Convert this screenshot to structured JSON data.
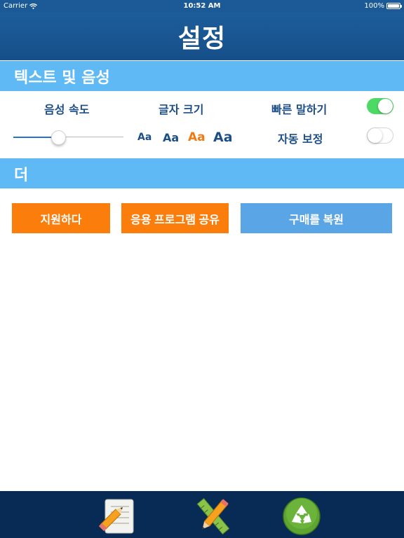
{
  "status_bar": {
    "carrier": "Carrier",
    "time": "10:52 AM",
    "battery": "100%"
  },
  "header": {
    "title": "설정"
  },
  "sections": {
    "text_and_voice": "텍스트 및 음성",
    "more": "더"
  },
  "settings": {
    "voice_speed_label": "음성 속도",
    "voice_speed_value": 0.4,
    "font_size_label": "글자 크기",
    "font_options": [
      "Aa",
      "Aa",
      "Aa",
      "Aa"
    ],
    "font_selected_index": 2,
    "fast_speech_label": "빠른 말하기",
    "fast_speech_on": true,
    "auto_correct_label": "자동 보정",
    "auto_correct_on": false
  },
  "buttons": {
    "support": "지원하다",
    "share_app": "응용 프로그램 공유",
    "restore_purchase": "구매를 복원"
  },
  "tabbar": {
    "items": [
      "notes-pencil-icon",
      "ruler-pencil-icon",
      "recycle-icon"
    ]
  },
  "colors": {
    "header": "#1b5a96",
    "section": "#5eb9f5",
    "orange": "#fb7d0c",
    "blue_button": "#5aa5e5",
    "tabbar": "#082b55",
    "toggle_on": "#4cd964"
  }
}
